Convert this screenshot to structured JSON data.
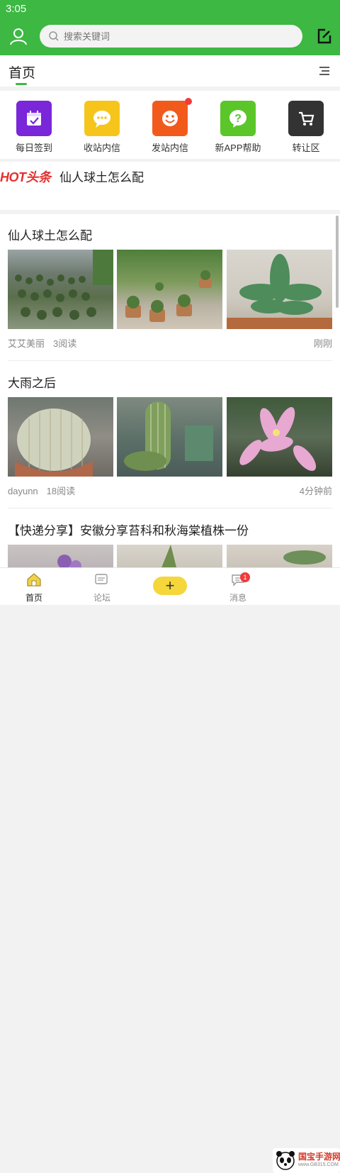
{
  "status": {
    "time": "3:05"
  },
  "header": {
    "search_placeholder": "搜索关键词"
  },
  "tabs": {
    "home_label": "首页"
  },
  "quick_links": [
    {
      "label": "每日签到",
      "icon": "calendar-check-icon",
      "color": "#7a26d9"
    },
    {
      "label": "收站内信",
      "icon": "chat-bubble-icon",
      "color": "#f6c51b"
    },
    {
      "label": "发站内信",
      "icon": "smiley-icon",
      "color": "#f25a1c"
    },
    {
      "label": "新APP帮助",
      "icon": "question-icon",
      "color": "#5ac629"
    },
    {
      "label": "转让区",
      "icon": "cart-icon",
      "color": "#333333"
    }
  ],
  "hot": {
    "logo": "HOT头条",
    "title": "仙人球土怎么配"
  },
  "posts": [
    {
      "title": "仙人球土怎么配",
      "author": "艾艾美丽",
      "reads": "3阅读",
      "time": "刚刚"
    },
    {
      "title": "大雨之后",
      "author": "dayunn",
      "reads": "18阅读",
      "time": "4分钟前"
    },
    {
      "title": "【快递分享】安徽分享苔科和秋海棠植株一份",
      "author": "",
      "reads": "",
      "time": ""
    }
  ],
  "bottom_nav": {
    "home": "首页",
    "forum": "论坛",
    "plus": "+",
    "messages": "消息",
    "message_badge": "1"
  },
  "watermark": {
    "brand": "国宝手游网",
    "url": "www.GB315.COM"
  },
  "colors": {
    "brand_green": "#3cb843",
    "hot_red": "#e53030",
    "plus_yellow": "#f5d63b"
  }
}
